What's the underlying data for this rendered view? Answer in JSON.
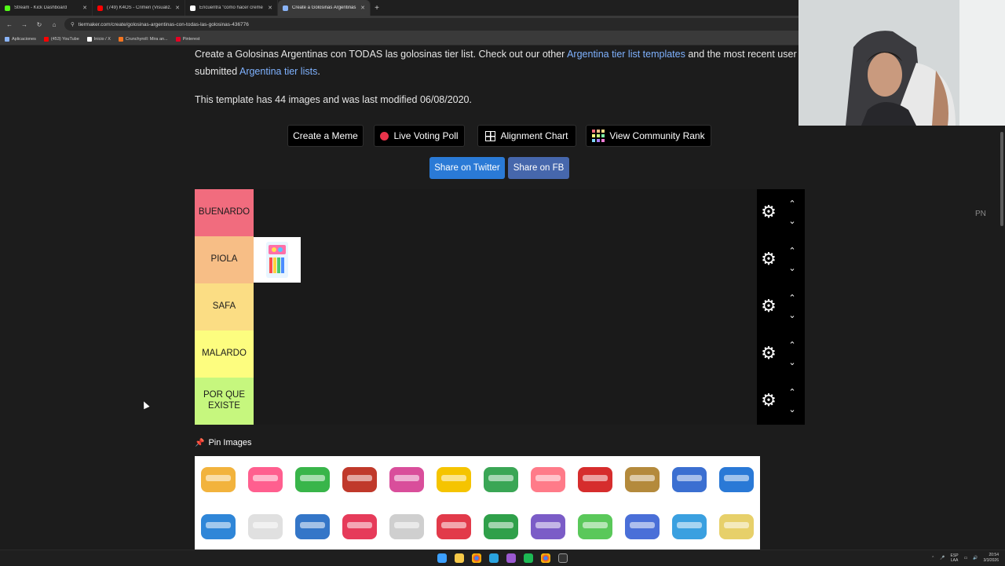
{
  "browser": {
    "tabs": [
      {
        "label": "Stream - Kick Dashboard",
        "color": "#53fc18"
      },
      {
        "label": "(749) K4OS - Crimen (Visualiz...",
        "color": "#ff0000"
      },
      {
        "label": "Encuentra \"como hacer creme ...",
        "color": "#ffffff"
      },
      {
        "label": "Create a Golosinas Argentinas ...",
        "color": "#8ab4f8"
      }
    ],
    "new_tab": "+",
    "url": "tiermaker.com/create/golosinas-argentinas-con-todas-las-golosinas-436776",
    "bookmarks": [
      {
        "label": "Aplicaciones",
        "color": "#8ab4f8"
      },
      {
        "label": "(453) YouTube",
        "color": "#ff0000"
      },
      {
        "label": "Inicio / X",
        "color": "#ffffff"
      },
      {
        "label": "Crunchyroll: Mira an...",
        "color": "#f47521"
      },
      {
        "label": "Pinterest",
        "color": "#e60023"
      }
    ]
  },
  "page": {
    "intro_text_1": "Create a Golosinas Argentinas con TODAS las golosinas tier list. Check out our other ",
    "intro_link_1": "Argentina tier list templates",
    "intro_text_2": " and the most recent user submitted ",
    "intro_link_2": "Argentina tier lists",
    "intro_text_3": ".",
    "template_info": "This template has 44 images and was last modified 06/08/2020.",
    "buttons": {
      "meme": "Create a Meme",
      "poll": "Live Voting Poll",
      "alignment": "Alignment Chart",
      "community": "View Community Rank"
    },
    "share": {
      "twitter": "Share on Twitter",
      "fb": "Share on FB"
    },
    "tiers": [
      {
        "label": "BUENARDO",
        "color": "#f16c7e"
      },
      {
        "label": "PIOLA",
        "color": "#f7be86"
      },
      {
        "label": "SAFA",
        "color": "#fbdd84"
      },
      {
        "label": "MALARDO",
        "color": "#fdfd7f"
      },
      {
        "label": "POR QUE EXISTE",
        "color": "#c6f77e"
      }
    ],
    "pin_images": "Pin Images",
    "side_label": "PN"
  },
  "taskbar": {
    "lang": "ESP\nLAA",
    "time": "20:54",
    "date": "3/3/2026"
  }
}
